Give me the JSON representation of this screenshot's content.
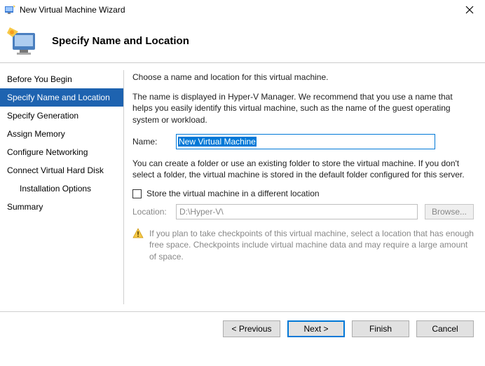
{
  "window": {
    "title": "New Virtual Machine Wizard"
  },
  "header": {
    "page_title": "Specify Name and Location"
  },
  "sidebar": {
    "steps": [
      "Before You Begin",
      "Specify Name and Location",
      "Specify Generation",
      "Assign Memory",
      "Configure Networking",
      "Connect Virtual Hard Disk",
      "Installation Options",
      "Summary"
    ],
    "selected_index": 1,
    "sub_indices": [
      6
    ]
  },
  "content": {
    "intro": "Choose a name and location for this virtual machine.",
    "name_help": "The name is displayed in Hyper-V Manager. We recommend that you use a name that helps you easily identify this virtual machine, such as the name of the guest operating system or workload.",
    "name_label": "Name:",
    "name_value": "New Virtual Machine",
    "folder_help": "You can create a folder or use an existing folder to store the virtual machine. If you don't select a folder, the virtual machine is stored in the default folder configured for this server.",
    "store_checkbox_label": "Store the virtual machine in a different location",
    "store_checked": false,
    "location_label": "Location:",
    "location_value": "D:\\Hyper-V\\",
    "browse_label": "Browse...",
    "warning_text": "If you plan to take checkpoints of this virtual machine, select a location that has enough free space. Checkpoints include virtual machine data and may require a large amount of space."
  },
  "footer": {
    "previous": "< Previous",
    "next": "Next >",
    "finish": "Finish",
    "cancel": "Cancel"
  }
}
